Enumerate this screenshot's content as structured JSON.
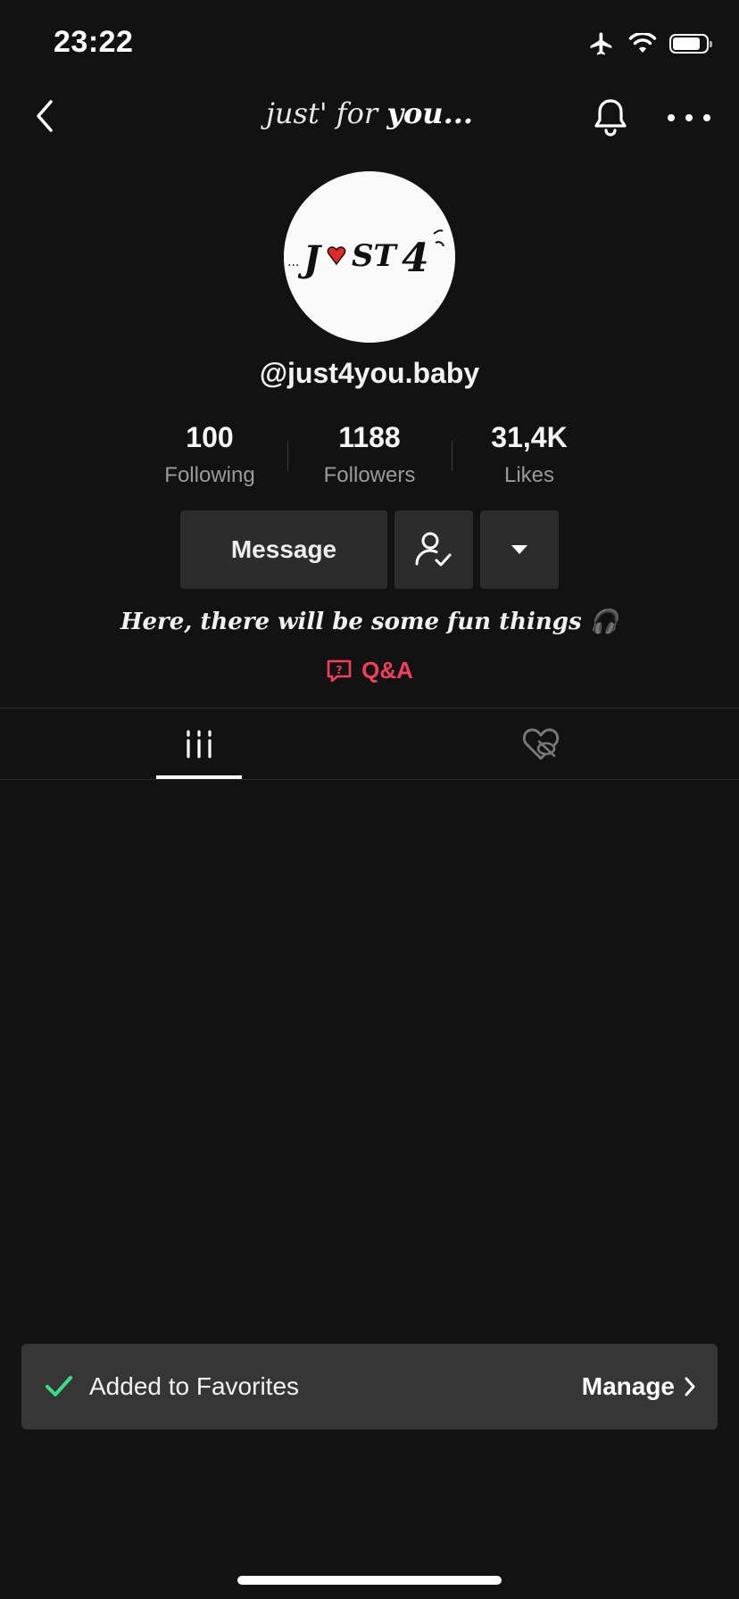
{
  "status_bar": {
    "time": "23:22",
    "icons": [
      "airplane-icon",
      "wifi-icon",
      "battery-icon"
    ],
    "battery_level": 0.75
  },
  "nav": {
    "title_light": "just' for ",
    "title_bold": "you...",
    "back_icon": "chevron-left-icon",
    "bell_icon": "bell-icon",
    "more_icon": "more-horizontal-icon"
  },
  "profile": {
    "avatar_text": "JUST 4",
    "handle": "@just4you.baby",
    "stats": [
      {
        "value": "100",
        "label": "Following"
      },
      {
        "value": "1188",
        "label": "Followers"
      },
      {
        "value": "31,4K",
        "label": "Likes"
      }
    ],
    "bio": "Here, there will be some fun things 🎧",
    "qa_label": "Q&A"
  },
  "buttons": {
    "message_label": "Message"
  },
  "tabs": [
    {
      "icon": "grid-icon",
      "active": true
    },
    {
      "icon": "liked-hidden-icon",
      "active": false
    }
  ],
  "toast": {
    "message": "Added to Favorites",
    "action_label": "Manage"
  },
  "colors": {
    "background": "#121212",
    "accent": "#f2405c",
    "toast_check": "#3ddc84",
    "button_bg": "#2c2c2c"
  }
}
